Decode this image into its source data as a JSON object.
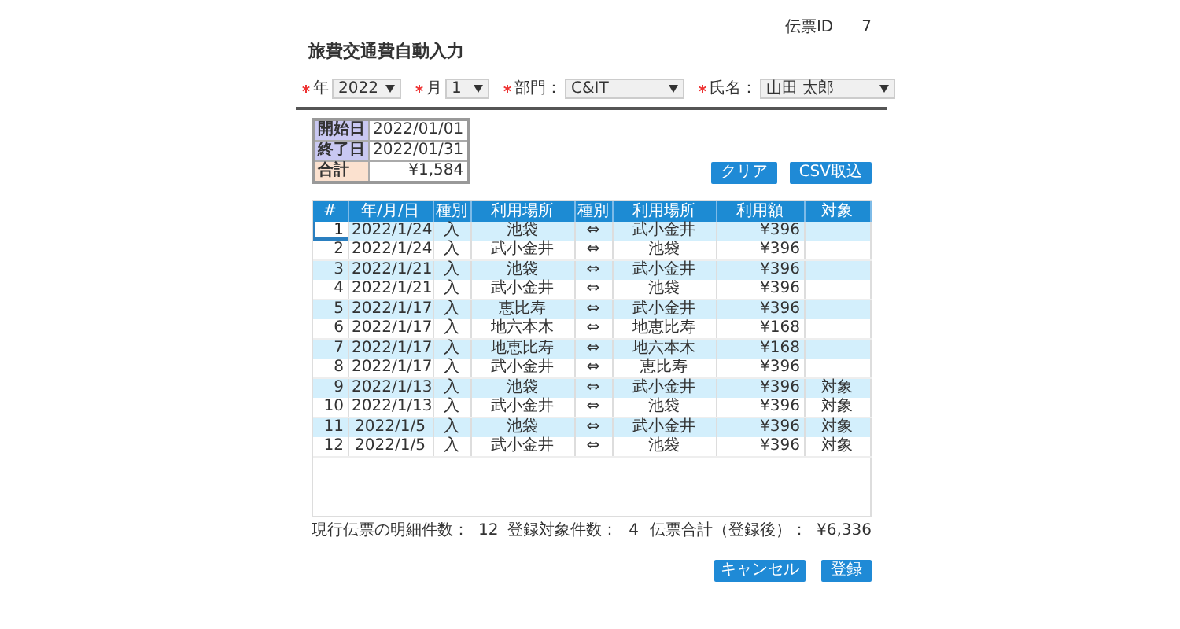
{
  "header": {
    "title": "旅費交通費自動入力",
    "slip_id_label": "伝票ID",
    "slip_id": "7"
  },
  "filters": [
    {
      "label": "年",
      "value": "2022",
      "required": true
    },
    {
      "label": "月",
      "value": "1",
      "required": true
    },
    {
      "label": "部門：",
      "value": "C&IT",
      "required": true
    },
    {
      "label": "氏名：",
      "value": "山田 太郎",
      "required": true
    }
  ],
  "summary": [
    {
      "label": "開始日",
      "value": "2022/01/01",
      "color": "#c9c8f2"
    },
    {
      "label": "終了日",
      "value": "2022/01/31",
      "color": "#c9c8f2"
    },
    {
      "label": "合計",
      "value": "¥1,584",
      "color": "#fbe1cf"
    }
  ],
  "actions": [
    "クリア",
    "CSV取込"
  ],
  "table": {
    "columns": [
      "#",
      "年/月/日",
      "種別",
      "利用場所",
      "種別",
      "利用場所",
      "利用額",
      "対象"
    ],
    "rows": [
      {
        "no": "1",
        "date": "2022/1/24",
        "type": "入",
        "from": "池袋",
        "dir": "⇔",
        "to": "武小金井",
        "amount": "¥396",
        "selected": true
      },
      {
        "no": "2",
        "date": "2022/1/24",
        "type": "入",
        "from": "武小金井",
        "dir": "⇔",
        "to": "池袋",
        "amount": "¥396",
        "selected": false
      },
      {
        "no": "3",
        "date": "2022/1/21",
        "type": "入",
        "from": "池袋",
        "dir": "⇔",
        "to": "武小金井",
        "amount": "¥396",
        "selected": false
      },
      {
        "no": "4",
        "date": "2022/1/21",
        "type": "入",
        "from": "武小金井",
        "dir": "⇔",
        "to": "池袋",
        "amount": "¥396",
        "selected": false
      },
      {
        "no": "5",
        "date": "2022/1/17",
        "type": "入",
        "from": "恵比寿",
        "dir": "⇔",
        "to": "武小金井",
        "amount": "¥396",
        "selected": false
      },
      {
        "no": "6",
        "date": "2022/1/17",
        "type": "入",
        "from": "地六本木",
        "dir": "⇔",
        "to": "地恵比寿",
        "amount": "¥168",
        "selected": false
      },
      {
        "no": "7",
        "date": "2022/1/17",
        "type": "入",
        "from": "地恵比寿",
        "dir": "⇔",
        "to": "地六本木",
        "amount": "¥168",
        "selected": false
      },
      {
        "no": "8",
        "date": "2022/1/17",
        "type": "入",
        "from": "武小金井",
        "dir": "⇔",
        "to": "恵比寿",
        "amount": "¥396",
        "selected": false
      },
      {
        "no": "9",
        "date": "2022/1/13",
        "type": "入",
        "from": "池袋",
        "dir": "⇔",
        "to": "武小金井",
        "amount": "¥396",
        "target": "対象",
        "selected": false
      },
      {
        "no": "10",
        "date": "2022/1/13",
        "type": "入",
        "from": "武小金井",
        "dir": "⇔",
        "to": "池袋",
        "amount": "¥396",
        "target": "対象",
        "selected": false
      },
      {
        "no": "11",
        "date": "2022/1/5",
        "type": "入",
        "from": "池袋",
        "dir": "⇔",
        "to": "武小金井",
        "amount": "¥396",
        "target": "対象",
        "selected": false
      },
      {
        "no": "12",
        "date": "2022/1/5",
        "type": "入",
        "from": "武小金井",
        "dir": "⇔",
        "to": "池袋",
        "amount": "¥396",
        "target": "対象",
        "selected": false
      }
    ]
  },
  "totals": [
    {
      "label": "現行伝票の明細件数：",
      "value": "12"
    },
    {
      "label": "登録対象件数：",
      "value": "4"
    },
    {
      "label": "伝票合計（登録後）：",
      "value": "¥6,336"
    }
  ],
  "buttons": [
    "キャンセル",
    "登録"
  ]
}
